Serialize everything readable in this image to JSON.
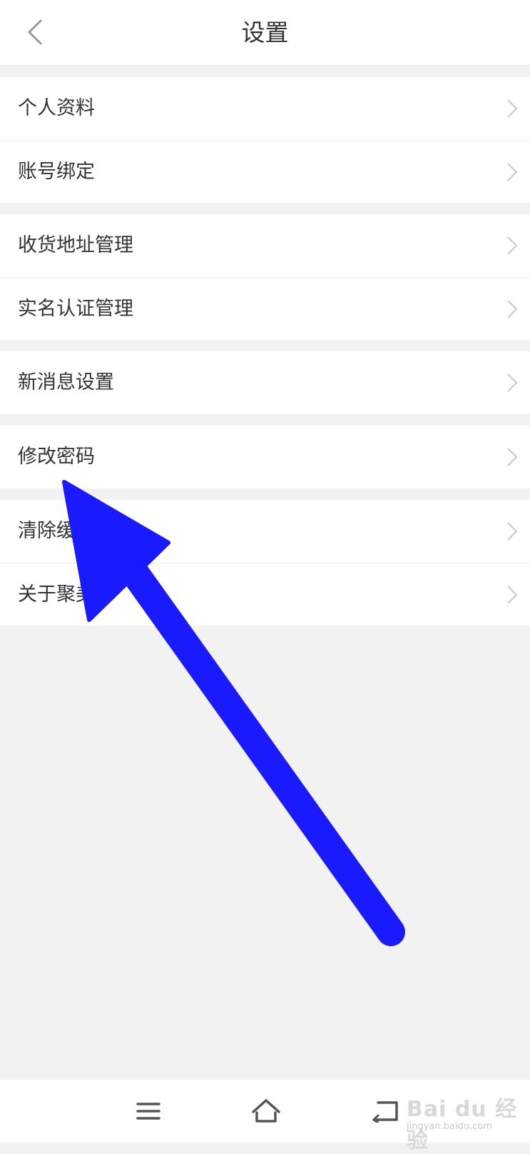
{
  "header": {
    "title": "设置",
    "back_icon": "chevron-left-icon"
  },
  "settings": {
    "items": [
      {
        "label": "个人资料"
      },
      {
        "label": "账号绑定"
      },
      {
        "label": "收货地址管理"
      },
      {
        "label": "实名认证管理"
      },
      {
        "label": "新消息设置"
      },
      {
        "label": "修改密码"
      },
      {
        "label": "清除缓"
      },
      {
        "label": "关于聚美"
      }
    ],
    "chevron_icon": "chevron-right-icon"
  },
  "bottom_nav": {
    "menu_icon": "menu-icon",
    "home_icon": "home-icon",
    "back_icon": "back-icon"
  },
  "annotation": {
    "arrow_color": "#1a1aff"
  },
  "watermark": {
    "text": "Bai du 经验",
    "sub": "jingyan.baidu.com"
  },
  "colors": {
    "background": "#f2f2f3",
    "surface": "#ffffff",
    "text": "#333333",
    "chevron": "#c8c8c8"
  }
}
